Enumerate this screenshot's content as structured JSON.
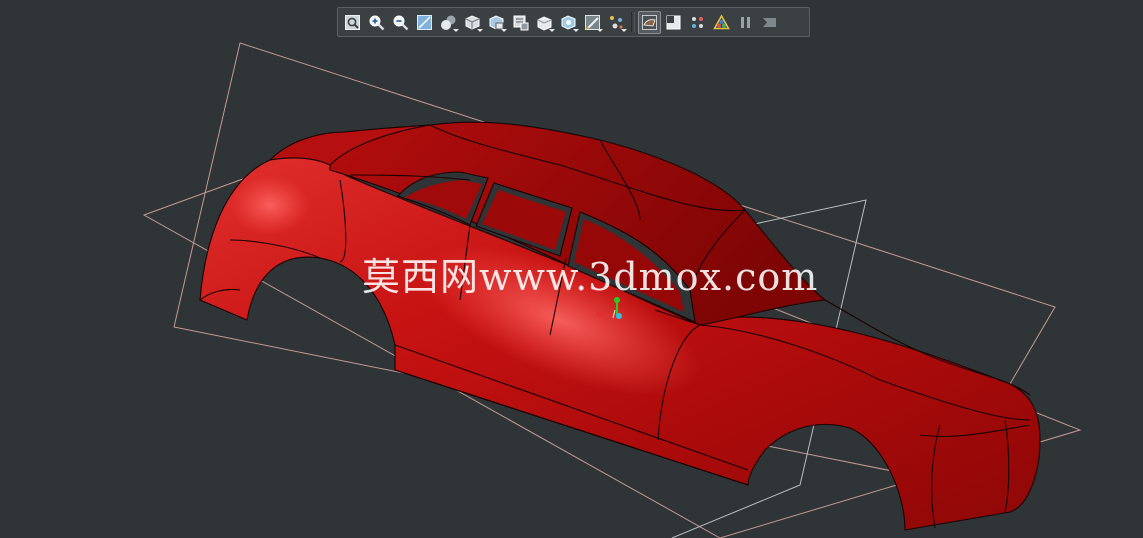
{
  "toolbar": {
    "buttons": [
      {
        "icon": "zoom-extents-icon"
      },
      {
        "icon": "zoom-in-icon"
      },
      {
        "icon": "zoom-out-icon"
      },
      {
        "icon": "zoom-window-icon"
      },
      {
        "icon": "render-mode-icon"
      },
      {
        "icon": "view-cube-icon"
      },
      {
        "icon": "standard-views-icon"
      },
      {
        "icon": "section-view-icon"
      },
      {
        "icon": "display-style-icon"
      },
      {
        "icon": "hide-show-icon"
      },
      {
        "icon": "edit-appearance-icon"
      },
      {
        "icon": "apply-scene-icon"
      },
      {
        "icon": "view-settings-icon",
        "active": true
      },
      {
        "icon": "shadows-icon"
      },
      {
        "icon": "cameras-icon"
      },
      {
        "icon": "realview-icon"
      },
      {
        "icon": "pause-icon"
      },
      {
        "icon": "exit-icon"
      }
    ]
  },
  "viewport": {
    "background_color": "#2f3436",
    "model_color": "#c00d0d",
    "plane_color": "#c49a95",
    "triad_colors": {
      "x": "#e03030",
      "y": "#20d020",
      "z": "#30c0e0"
    }
  },
  "watermark": {
    "text": "莫西网www.3dmox.com"
  }
}
